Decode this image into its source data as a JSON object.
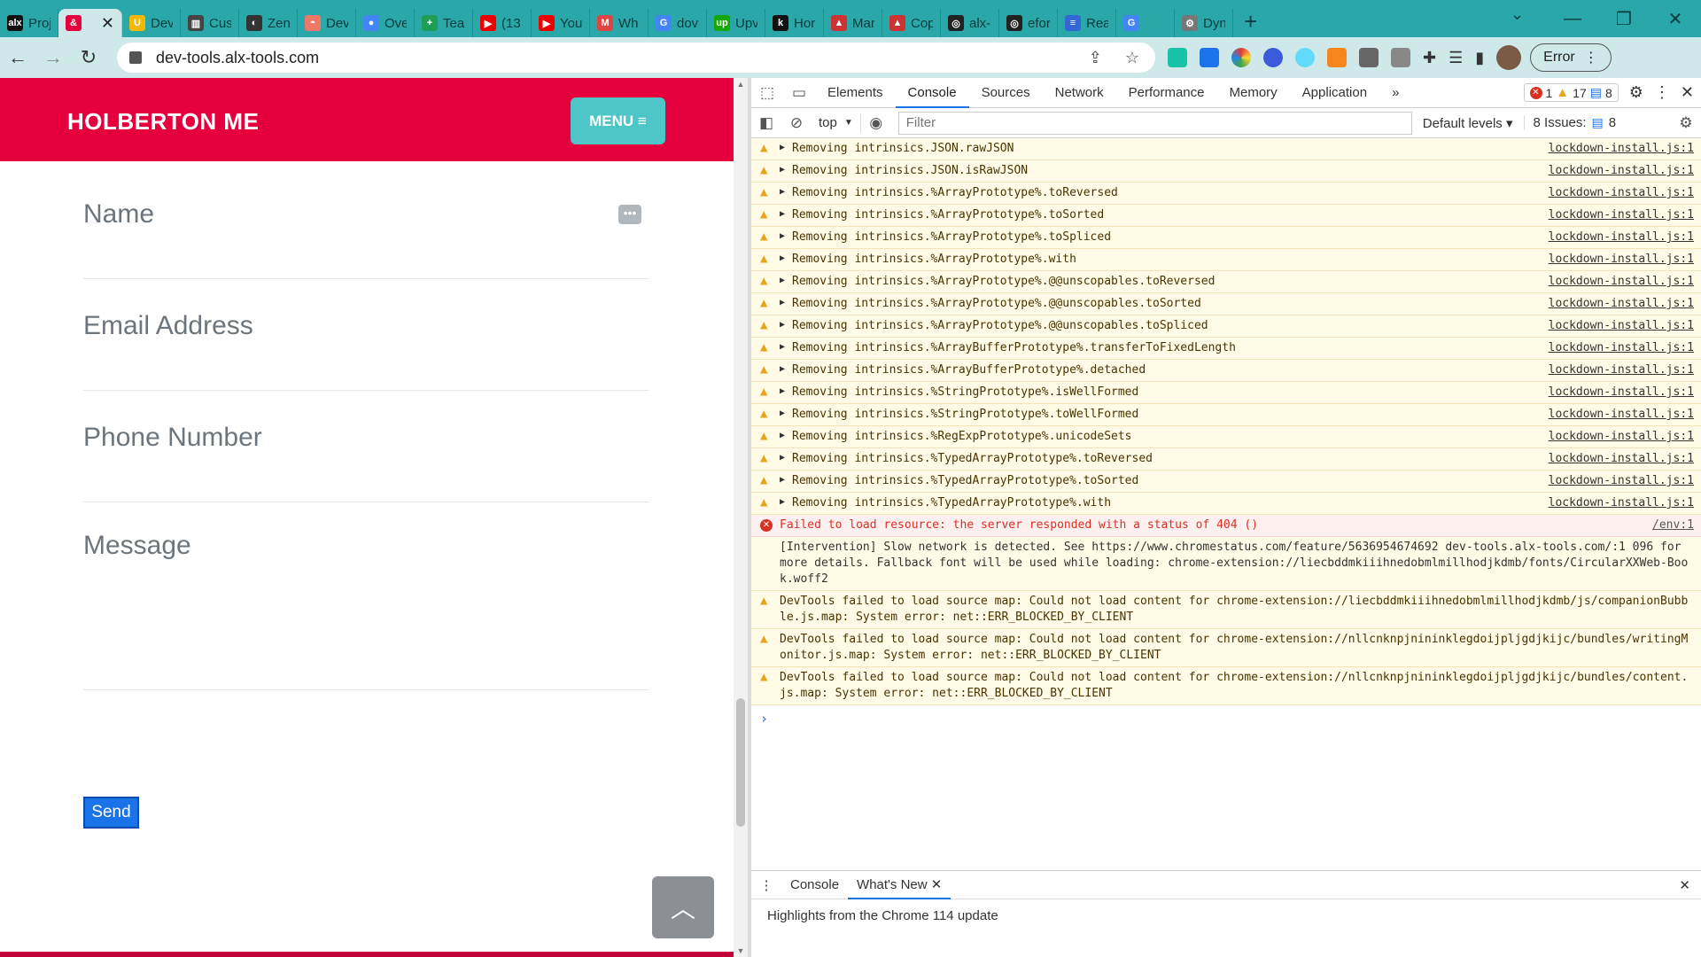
{
  "browser": {
    "tabs": [
      {
        "label": "Proj",
        "fav": "alx",
        "color": "#111"
      },
      {
        "label": "",
        "fav": "&",
        "color": "#e5003d",
        "active": true
      },
      {
        "label": "Dev",
        "fav": "U",
        "color": "#f5b800"
      },
      {
        "label": "Cus",
        "fav": "▥",
        "color": "#444"
      },
      {
        "label": "Zen",
        "fav": "◐",
        "color": "#333"
      },
      {
        "label": "Dev",
        "fav": "◓",
        "color": "#e76"
      },
      {
        "label": "Ove",
        "fav": "●",
        "color": "#4285f4"
      },
      {
        "label": "Tear",
        "fav": "+",
        "color": "#1e9e55"
      },
      {
        "label": "(13",
        "fav": "▶",
        "color": "#e00"
      },
      {
        "label": "You",
        "fav": "▶",
        "color": "#e00"
      },
      {
        "label": "Wh",
        "fav": "M",
        "color": "#d44"
      },
      {
        "label": "dov",
        "fav": "G",
        "color": "#4285f4"
      },
      {
        "label": "Upv",
        "fav": "up",
        "color": "#14a800"
      },
      {
        "label": "Hor",
        "fav": "k",
        "color": "#111"
      },
      {
        "label": "Mar",
        "fav": "▲",
        "color": "#c33"
      },
      {
        "label": "Cop",
        "fav": "▲",
        "color": "#c33"
      },
      {
        "label": "alx-",
        "fav": "◎",
        "color": "#222"
      },
      {
        "label": "efor",
        "fav": "◎",
        "color": "#222"
      },
      {
        "label": "Rea",
        "fav": "≡",
        "color": "#3367d6"
      },
      {
        "label": "",
        "fav": "G",
        "color": "#4285f4"
      },
      {
        "label": "Dyn",
        "fav": "⚙",
        "color": "#777"
      }
    ],
    "close_label": "✕",
    "add_label": "+",
    "url": "dev-tools.alx-tools.com",
    "error_label": "Error"
  },
  "page": {
    "brand": "HOLBERTON ME",
    "menu_label": "MENU ≡",
    "name_label": "Name",
    "email_label": "Email Address",
    "phone_label": "Phone Number",
    "message_label": "Message",
    "send_label": "Send"
  },
  "devtools": {
    "tabs": [
      "Elements",
      "Console",
      "Sources",
      "Network",
      "Performance",
      "Memory",
      "Application"
    ],
    "active_tab": "Console",
    "more_label": "»",
    "errors_count": "1",
    "warnings_count": "17",
    "messages_count": "8",
    "context": "top",
    "filter_placeholder": "Filter",
    "levels_label": "Default levels",
    "issues_label": "8 Issues:",
    "issues_count": "8",
    "console": [
      {
        "type": "warn",
        "text": "Removing intrinsics.JSON.rawJSON",
        "src": "lockdown-install.js:1"
      },
      {
        "type": "warn",
        "text": "Removing intrinsics.JSON.isRawJSON",
        "src": "lockdown-install.js:1"
      },
      {
        "type": "warn",
        "text": "Removing intrinsics.%ArrayPrototype%.toReversed",
        "src": "lockdown-install.js:1"
      },
      {
        "type": "warn",
        "text": "Removing intrinsics.%ArrayPrototype%.toSorted",
        "src": "lockdown-install.js:1"
      },
      {
        "type": "warn",
        "text": "Removing intrinsics.%ArrayPrototype%.toSpliced",
        "src": "lockdown-install.js:1"
      },
      {
        "type": "warn",
        "text": "Removing intrinsics.%ArrayPrototype%.with",
        "src": "lockdown-install.js:1"
      },
      {
        "type": "warn",
        "text": "Removing intrinsics.%ArrayPrototype%.@@unscopables.toReversed",
        "src": "lockdown-install.js:1"
      },
      {
        "type": "warn",
        "text": "Removing intrinsics.%ArrayPrototype%.@@unscopables.toSorted",
        "src": "lockdown-install.js:1"
      },
      {
        "type": "warn",
        "text": "Removing intrinsics.%ArrayPrototype%.@@unscopables.toSpliced",
        "src": "lockdown-install.js:1"
      },
      {
        "type": "warn",
        "text": "Removing intrinsics.%ArrayBufferPrototype%.transferToFixedLength",
        "src": "lockdown-install.js:1"
      },
      {
        "type": "warn",
        "text": "Removing intrinsics.%ArrayBufferPrototype%.detached",
        "src": "lockdown-install.js:1"
      },
      {
        "type": "warn",
        "text": "Removing intrinsics.%StringPrototype%.isWellFormed",
        "src": "lockdown-install.js:1"
      },
      {
        "type": "warn",
        "text": "Removing intrinsics.%StringPrototype%.toWellFormed",
        "src": "lockdown-install.js:1"
      },
      {
        "type": "warn",
        "text": "Removing intrinsics.%RegExpPrototype%.unicodeSets",
        "src": "lockdown-install.js:1"
      },
      {
        "type": "warn",
        "text": "Removing intrinsics.%TypedArrayPrototype%.toReversed",
        "src": "lockdown-install.js:1"
      },
      {
        "type": "warn",
        "text": "Removing intrinsics.%TypedArrayPrototype%.toSorted",
        "src": "lockdown-install.js:1"
      },
      {
        "type": "warn",
        "text": "Removing intrinsics.%TypedArrayPrototype%.with",
        "src": "lockdown-install.js:1"
      },
      {
        "type": "error",
        "text": "Failed to load resource: the server responded with a status of 404 ()",
        "src": "/env:1"
      },
      {
        "type": "info",
        "text": "[Intervention] Slow network is detected. See https://www.chromestatus.com/feature/5636954674692 dev-tools.alx-tools.com/:1 096 for more details. Fallback font will be used while loading: chrome-extension://liecbddmkiiihnedobmlmillhodjkdmb/fonts/CircularXXWeb-Book.woff2",
        "src": ""
      },
      {
        "type": "warn-plain",
        "text": "DevTools failed to load source map: Could not load content for chrome-extension://liecbddmkiiihnedobmlmillhodjkdmb/js/companionBubble.js.map: System error: net::ERR_BLOCKED_BY_CLIENT",
        "src": ""
      },
      {
        "type": "warn-plain",
        "text": "DevTools failed to load source map: Could not load content for chrome-extension://nllcnknpjnininklegdoijpljgdjkijc/bundles/writingMonitor.js.map: System error: net::ERR_BLOCKED_BY_CLIENT",
        "src": ""
      },
      {
        "type": "warn-plain",
        "text": "DevTools failed to load source map: Could not load content for chrome-extension://nllcnknpjnininklegdoijpljgdjkijc/bundles/content.js.map: System error: net::ERR_BLOCKED_BY_CLIENT",
        "src": ""
      }
    ],
    "drawer_tabs": [
      "Console",
      "What's New"
    ],
    "drawer_active": "What's New",
    "drawer_text": "Highlights from the Chrome 114 update"
  }
}
